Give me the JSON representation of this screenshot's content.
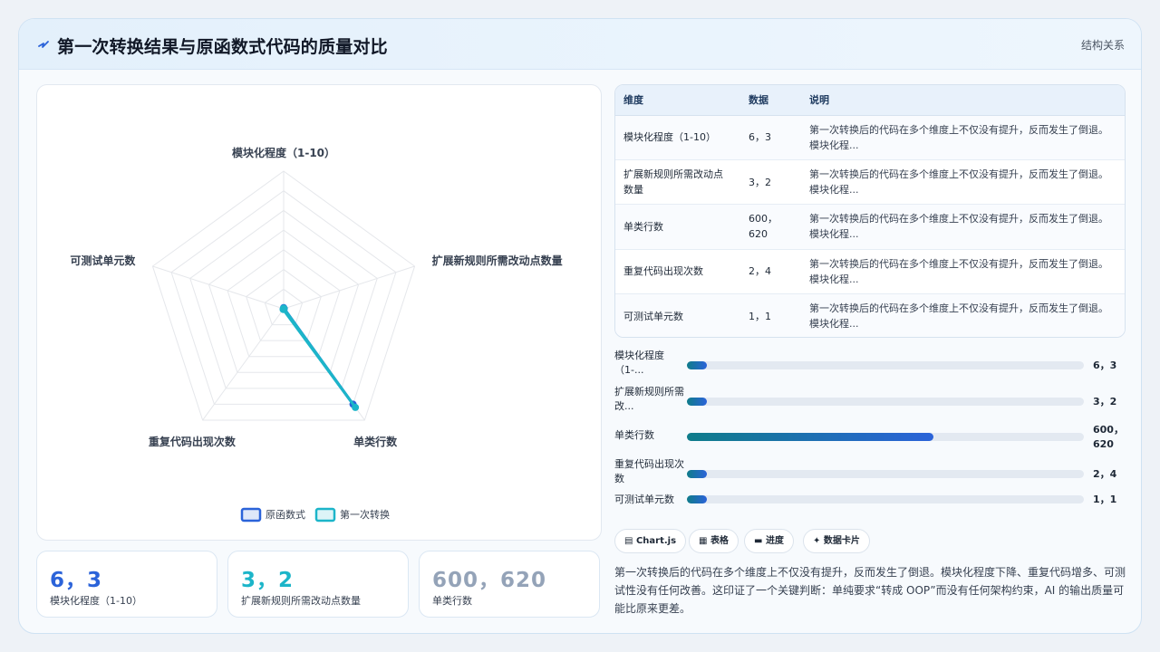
{
  "header": {
    "title": "第一次转换结果与原函数式代码的质量对比",
    "tag": "结构关系",
    "icon": "bolt-icon"
  },
  "chart_data": {
    "type": "radar",
    "axes": [
      "模块化程度（1-10）",
      "扩展新规则所需改动点数量",
      "单类行数",
      "重复代码出现次数",
      "可测试单元数"
    ],
    "series": [
      {
        "name": "原函数式",
        "values": [
          6,
          3,
          600,
          2,
          1
        ],
        "color": "#2b63d9"
      },
      {
        "name": "第一次转换",
        "values": [
          3,
          2,
          620,
          4,
          1
        ],
        "color": "#1cb5c9"
      }
    ],
    "rmax": 700,
    "rings": 7,
    "legend_position": "bottom"
  },
  "stats": [
    {
      "value": "6，3",
      "label": "模块化程度（1-10）",
      "color": "#2b63d9"
    },
    {
      "value": "3，2",
      "label": "扩展新规则所需改动点数量",
      "color": "#1cb5c9"
    },
    {
      "value": "600，620",
      "label": "单类行数",
      "color": "#94a3b8"
    }
  ],
  "table": {
    "headers": [
      "维度",
      "数据",
      "说明"
    ],
    "rows": [
      {
        "dim": "模块化程度（1-10）",
        "data": "6，3",
        "desc": "第一次转换后的代码在多个维度上不仅没有提升，反而发生了倒退。模块化程..."
      },
      {
        "dim": "扩展新规则所需改动点数量",
        "data": "3，2",
        "desc": "第一次转换后的代码在多个维度上不仅没有提升，反而发生了倒退。模块化程..."
      },
      {
        "dim": "单类行数",
        "data": "600，620",
        "desc": "第一次转换后的代码在多个维度上不仅没有提升，反而发生了倒退。模块化程..."
      },
      {
        "dim": "重复代码出现次数",
        "data": "2，4",
        "desc": "第一次转换后的代码在多个维度上不仅没有提升，反而发生了倒退。模块化程..."
      },
      {
        "dim": "可测试单元数",
        "data": "1，1",
        "desc": "第一次转换后的代码在多个维度上不仅没有提升，反而发生了倒退。模块化程..."
      }
    ]
  },
  "bars": [
    {
      "label": "模块化程度（1-...",
      "value": "6，3",
      "fill": 0.05
    },
    {
      "label": "扩展新规则所需改...",
      "value": "3，2",
      "fill": 0.05
    },
    {
      "label": "单类行数",
      "value": "600，620",
      "fill": 0.62
    },
    {
      "label": "重复代码出现次数",
      "value": "2，4",
      "fill": 0.05
    },
    {
      "label": "可测试单元数",
      "value": "1，1",
      "fill": 0.05
    }
  ],
  "chips": [
    {
      "icon": "chart-icon",
      "label": "Chart.js"
    },
    {
      "icon": "table-icon",
      "label": "表格"
    },
    {
      "icon": "progress-icon",
      "label": "进度"
    },
    {
      "icon": "sparkle-icon",
      "label": "数据卡片"
    }
  ],
  "summary": "第一次转换后的代码在多个维度上不仅没有提升，反而发生了倒退。模块化程度下降、重复代码增多、可测试性没有任何改善。这印证了一个关键判断：单纯要求“转成 OOP”而没有任何架构约束，AI 的输出质量可能比原来更差。"
}
